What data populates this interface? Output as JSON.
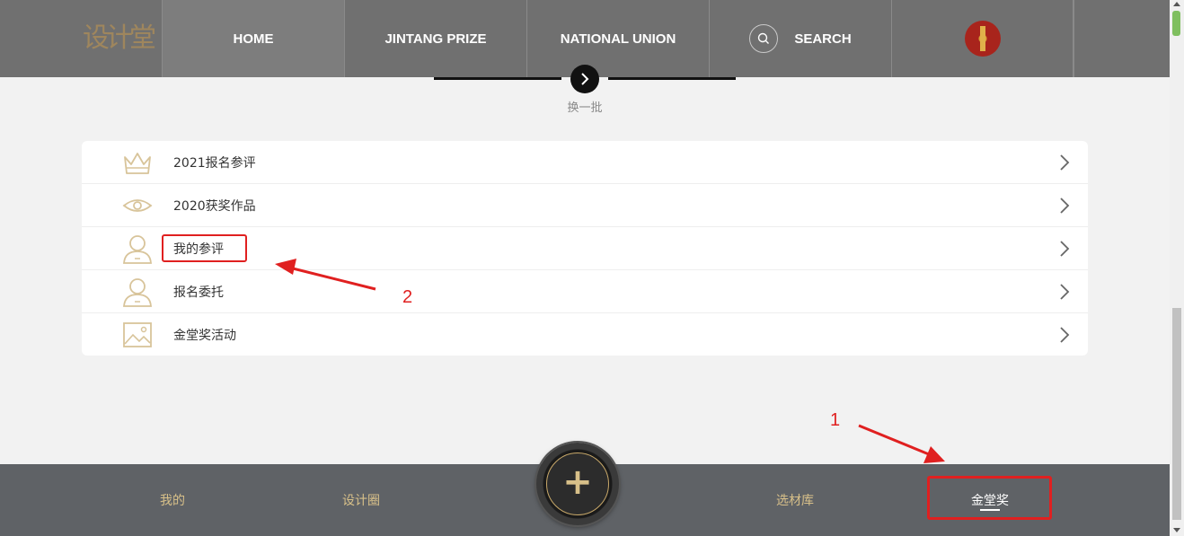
{
  "nav": {
    "logo_text": "设计堂",
    "items": [
      {
        "label": "HOME",
        "active": true
      },
      {
        "label": "JINTANG PRIZE",
        "active": false
      },
      {
        "label": "NATIONAL UNION",
        "active": false
      },
      {
        "label": "SEARCH",
        "active": false
      }
    ],
    "search_icon": "search-icon"
  },
  "switch_batch": {
    "label": "换一批",
    "icon": "chevron-right-icon"
  },
  "menu": [
    {
      "label": "2021报名参评",
      "icon": "crown-icon"
    },
    {
      "label": "2020获奖作品",
      "icon": "eye-icon"
    },
    {
      "label": "我的参评",
      "icon": "user-icon"
    },
    {
      "label": "报名委托",
      "icon": "user-icon"
    },
    {
      "label": "金堂奖活动",
      "icon": "image-icon"
    }
  ],
  "annotations": {
    "num_1": "1",
    "num_2": "2",
    "color": "#e02020"
  },
  "bottom_tabs": [
    {
      "label": "我的",
      "active": false
    },
    {
      "label": "设计圈",
      "active": false
    },
    {
      "label": "选材库",
      "active": false
    },
    {
      "label": "金堂奖",
      "active": true
    }
  ],
  "plus_label": "+",
  "colors": {
    "gold": "#d8c089",
    "nav_bg": "#707070",
    "bottom_bg": "#5f6266",
    "icon_tan": "#d8c49a"
  }
}
